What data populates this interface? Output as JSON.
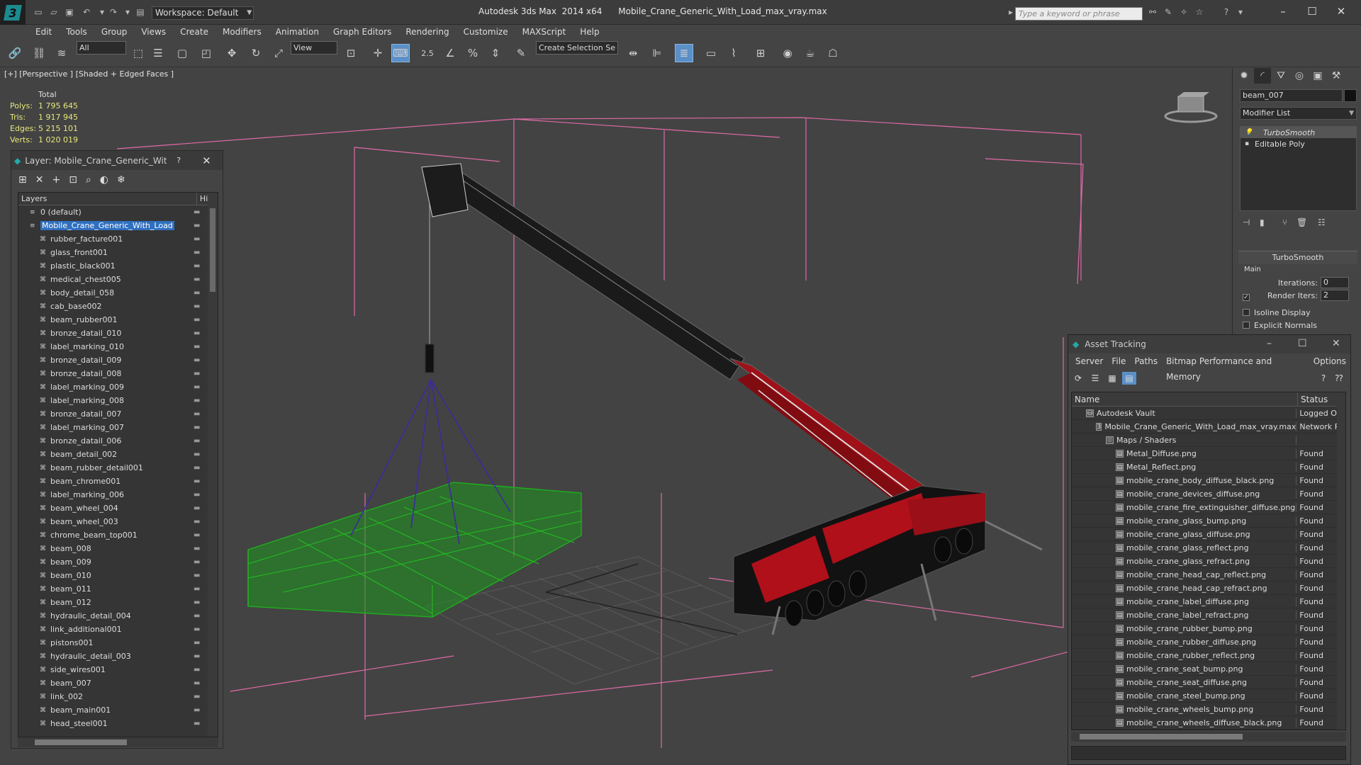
{
  "app": {
    "title": "Autodesk 3ds Max  2014 x64      Mobile_Crane_Generic_With_Load_max_vray.max",
    "workspace": "Workspace: Default",
    "search_placeholder": "Type a keyword or phrase"
  },
  "menu": [
    "Edit",
    "Tools",
    "Group",
    "Views",
    "Create",
    "Modifiers",
    "Animation",
    "Graph Editors",
    "Rendering",
    "Customize",
    "MAXScript",
    "Help"
  ],
  "toolbar": {
    "filter_value": "All",
    "refcoord_value": "View",
    "selection_set_placeholder": "Create Selection Se",
    "snap_label": "2.5"
  },
  "viewport": {
    "label": "[+] [Perspective ] [Shaded + Edged Faces ]",
    "stats": {
      "header": "Total",
      "rows": [
        {
          "k": "Polys:",
          "v": "1 795 645"
        },
        {
          "k": "Tris:",
          "v": "1 917 945"
        },
        {
          "k": "Edges:",
          "v": "5 215 101"
        },
        {
          "k": "Verts:",
          "v": "1 020 019"
        }
      ]
    }
  },
  "layer_dialog": {
    "title": "Layer: Mobile_Crane_Generic_Wit...",
    "help": "?",
    "col_layers": "Layers",
    "col_hide": "Hide",
    "rows": [
      {
        "name": "0 (default)",
        "level": 0
      },
      {
        "name": "Mobile_Crane_Generic_With_Load",
        "level": 0,
        "selected": true
      },
      {
        "name": "rubber_facture001",
        "level": 1
      },
      {
        "name": "glass_front001",
        "level": 1
      },
      {
        "name": "plastic_black001",
        "level": 1
      },
      {
        "name": "medical_chest005",
        "level": 1
      },
      {
        "name": "body_detail_058",
        "level": 1
      },
      {
        "name": "cab_base002",
        "level": 1
      },
      {
        "name": "beam_rubber001",
        "level": 1
      },
      {
        "name": "bronze_datail_010",
        "level": 1
      },
      {
        "name": "label_marking_010",
        "level": 1
      },
      {
        "name": "bronze_datail_009",
        "level": 1
      },
      {
        "name": "bronze_datail_008",
        "level": 1
      },
      {
        "name": "label_marking_009",
        "level": 1
      },
      {
        "name": "label_marking_008",
        "level": 1
      },
      {
        "name": "bronze_datail_007",
        "level": 1
      },
      {
        "name": "label_marking_007",
        "level": 1
      },
      {
        "name": "bronze_datail_006",
        "level": 1
      },
      {
        "name": "beam_detail_002",
        "level": 1
      },
      {
        "name": "beam_rubber_detail001",
        "level": 1
      },
      {
        "name": "beam_chrome001",
        "level": 1
      },
      {
        "name": "label_marking_006",
        "level": 1
      },
      {
        "name": "beam_wheel_004",
        "level": 1
      },
      {
        "name": "beam_wheel_003",
        "level": 1
      },
      {
        "name": "chrome_beam_top001",
        "level": 1
      },
      {
        "name": "beam_008",
        "level": 1
      },
      {
        "name": "beam_009",
        "level": 1
      },
      {
        "name": "beam_010",
        "level": 1
      },
      {
        "name": "beam_011",
        "level": 1
      },
      {
        "name": "beam_012",
        "level": 1
      },
      {
        "name": "hydraulic_detail_004",
        "level": 1
      },
      {
        "name": "link_additional001",
        "level": 1
      },
      {
        "name": "pistons001",
        "level": 1
      },
      {
        "name": "hydraulic_detail_003",
        "level": 1
      },
      {
        "name": "side_wires001",
        "level": 1
      },
      {
        "name": "beam_007",
        "level": 1
      },
      {
        "name": "link_002",
        "level": 1
      },
      {
        "name": "beam_main001",
        "level": 1
      },
      {
        "name": "head_steel001",
        "level": 1
      }
    ]
  },
  "command_panel": {
    "object_name": "beam_007",
    "modifier_list": "Modifier List",
    "stack": [
      "TurboSmooth",
      "Editable Poly"
    ],
    "rollout_title": "TurboSmooth",
    "section_main": "Main",
    "iterations_label": "Iterations:",
    "iterations_value": "0",
    "render_iters_label": "Render Iters:",
    "render_iters_value": "2",
    "render_iters_checked": "✓",
    "isoline_label": "Isoline Display",
    "explicit_normals_label": "Explicit Normals"
  },
  "asset_tracking": {
    "title": "Asset Tracking",
    "menu": [
      "Server",
      "File",
      "Paths",
      "Bitmap Performance and Memory",
      "Options"
    ],
    "col_name": "Name",
    "col_status": "Status",
    "rows": [
      {
        "name": "Autodesk Vault",
        "status": "Logged O",
        "level": 0,
        "icon": "vault"
      },
      {
        "name": "Mobile_Crane_Generic_With_Load_max_vray.max",
        "status": "Network P",
        "level": 1,
        "icon": "max"
      },
      {
        "name": "Maps / Shaders",
        "status": "",
        "level": 2,
        "icon": "maps"
      },
      {
        "name": "Metal_Diffuse.png",
        "status": "Found",
        "level": 3,
        "icon": "file"
      },
      {
        "name": "Metal_Reflect.png",
        "status": "Found",
        "level": 3,
        "icon": "file"
      },
      {
        "name": "mobile_crane_body_diffuse_black.png",
        "status": "Found",
        "level": 3,
        "icon": "file"
      },
      {
        "name": "mobile_crane_devices_diffuse.png",
        "status": "Found",
        "level": 3,
        "icon": "file"
      },
      {
        "name": "mobile_crane_fire_extinguisher_diffuse.png",
        "status": "Found",
        "level": 3,
        "icon": "file"
      },
      {
        "name": "mobile_crane_glass_bump.png",
        "status": "Found",
        "level": 3,
        "icon": "file"
      },
      {
        "name": "mobile_crane_glass_diffuse.png",
        "status": "Found",
        "level": 3,
        "icon": "file"
      },
      {
        "name": "mobile_crane_glass_reflect.png",
        "status": "Found",
        "level": 3,
        "icon": "file"
      },
      {
        "name": "mobile_crane_glass_refract.png",
        "status": "Found",
        "level": 3,
        "icon": "file"
      },
      {
        "name": "mobile_crane_head_cap_reflect.png",
        "status": "Found",
        "level": 3,
        "icon": "file"
      },
      {
        "name": "mobile_crane_head_cap_refract.png",
        "status": "Found",
        "level": 3,
        "icon": "file"
      },
      {
        "name": "mobile_crane_label_diffuse.png",
        "status": "Found",
        "level": 3,
        "icon": "file"
      },
      {
        "name": "mobile_crane_label_refract.png",
        "status": "Found",
        "level": 3,
        "icon": "file"
      },
      {
        "name": "mobile_crane_rubber_bump.png",
        "status": "Found",
        "level": 3,
        "icon": "file"
      },
      {
        "name": "mobile_crane_rubber_diffuse.png",
        "status": "Found",
        "level": 3,
        "icon": "file"
      },
      {
        "name": "mobile_crane_rubber_reflect.png",
        "status": "Found",
        "level": 3,
        "icon": "file"
      },
      {
        "name": "mobile_crane_seat_bump.png",
        "status": "Found",
        "level": 3,
        "icon": "file"
      },
      {
        "name": "mobile_crane_seat_diffuse.png",
        "status": "Found",
        "level": 3,
        "icon": "file"
      },
      {
        "name": "mobile_crane_steel_bump.png",
        "status": "Found",
        "level": 3,
        "icon": "file"
      },
      {
        "name": "mobile_crane_wheels_bump.png",
        "status": "Found",
        "level": 3,
        "icon": "file"
      },
      {
        "name": "mobile_crane_wheels_diffuse_black.png",
        "status": "Found",
        "level": 3,
        "icon": "file"
      }
    ]
  },
  "colors": {
    "selection_blue": "#2f6fbf",
    "stats_yellow": "#e6e87c",
    "wire_pink": "#e06aa8",
    "load_green": "#1fae1f",
    "crane_red": "#c0101a"
  }
}
